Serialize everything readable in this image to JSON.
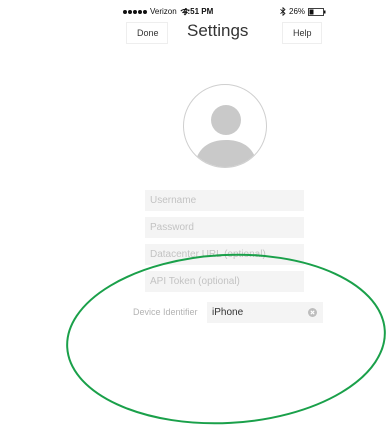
{
  "status_bar": {
    "carrier": "Verizon",
    "time": "4:51 PM",
    "battery": "26%"
  },
  "nav": {
    "done_label": "Done",
    "title": "Settings",
    "help_label": "Help"
  },
  "form": {
    "username_placeholder": "Username",
    "password_placeholder": "Password",
    "datacenter_placeholder": "Datacenter URL (optional)",
    "token_placeholder": "API Token (optional)",
    "device_label": "Device Identifier",
    "device_value": "iPhone"
  },
  "colors": {
    "annotation": "#1aa04a",
    "field_bg": "#f4f4f4",
    "placeholder": "#c3c3c3"
  },
  "icons": {
    "avatar": "person-silhouette-icon",
    "clear": "clear-circle-icon",
    "wifi": "wifi-icon",
    "bluetooth": "bluetooth-icon",
    "battery": "battery-icon"
  }
}
